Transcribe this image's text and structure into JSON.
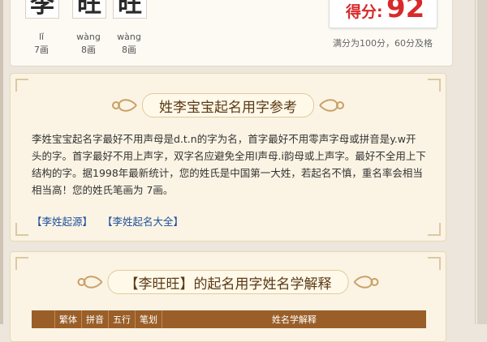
{
  "chars": [
    {
      "char": "李",
      "pinyin": "lǐ",
      "strokes": "7画"
    },
    {
      "char": "旺",
      "pinyin": "wàng",
      "strokes": "8画"
    },
    {
      "char": "旺",
      "pinyin": "wàng",
      "strokes": "8画"
    }
  ],
  "score": {
    "label": "得分:",
    "value": "92",
    "note": "满分为100分，60分及格"
  },
  "reference": {
    "title": "姓李宝宝起名用字参考",
    "text": "李姓宝宝起名字最好不用声母是d.t.n的字为名，首字最好不用零声字母或拼音是y.w开头的字。首字最好不用上声字，双字名应避免全用l声母.i韵母或上声字。最好不全用上下结构的字。据1998年最新统计，您的姓氏是中国第一大姓，若起名不慎，重名率会相当相当高！您的姓氏笔画为 7画。",
    "links": [
      "【李姓起源】",
      "【李姓起名大全】"
    ]
  },
  "analysis": {
    "title": "【李旺旺】的起名用字姓名学解释",
    "columns": [
      "",
      "繁体",
      "拼音",
      "五行",
      "笔划",
      "姓名学解释"
    ]
  },
  "colors": {
    "accent_red": "#d72a2a",
    "table_header": "#9a5e28",
    "link": "#1f4e9c"
  }
}
